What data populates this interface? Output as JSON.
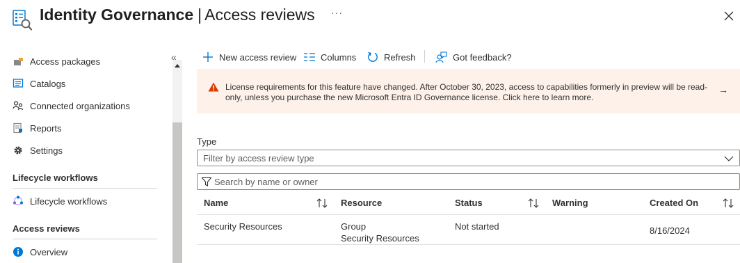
{
  "header": {
    "title": "Identity Governance",
    "separator": "|",
    "subtitle": "Access reviews",
    "more_label": "···",
    "icon": "identity-governance-icon"
  },
  "sidebar": {
    "collapse_label": "«",
    "items": [
      {
        "label": "Access packages",
        "icon": "access-packages-icon"
      },
      {
        "label": "Catalogs",
        "icon": "catalogs-icon"
      },
      {
        "label": "Connected organizations",
        "icon": "connected-organizations-icon"
      },
      {
        "label": "Reports",
        "icon": "reports-icon"
      },
      {
        "label": "Settings",
        "icon": "gear-icon"
      }
    ],
    "section_lifecycle": "Lifecycle workflows",
    "lifecycle_item": {
      "label": "Lifecycle workflows",
      "icon": "lifecycle-icon"
    },
    "section_access_reviews": "Access reviews",
    "overview_item": {
      "label": "Overview",
      "icon": "info-icon"
    }
  },
  "toolbar": {
    "new_label": "New access review",
    "columns_label": "Columns",
    "refresh_label": "Refresh",
    "feedback_label": "Got feedback?"
  },
  "banner": {
    "text": "License requirements for this feature have changed. After October 30, 2023, access to capabilities formerly in preview will be read-only, unless you purchase the new Microsoft Entra ID Governance license. Click here to learn more.",
    "arrow": "→"
  },
  "filters": {
    "type_label": "Type",
    "type_placeholder": "Filter by access review type",
    "search_placeholder": "Search by name or owner"
  },
  "table": {
    "headers": {
      "name": "Name",
      "resource": "Resource",
      "status": "Status",
      "warning": "Warning",
      "created": "Created On"
    },
    "rows": [
      {
        "name": "Security Resources",
        "resource_type": "Group",
        "resource_name": "Security Resources",
        "status": "Not started",
        "warning": "",
        "created": "8/16/2024"
      }
    ]
  },
  "colors": {
    "accent": "#0078d4",
    "banner_bg": "#fdf1ea",
    "warning": "#d83b01"
  }
}
